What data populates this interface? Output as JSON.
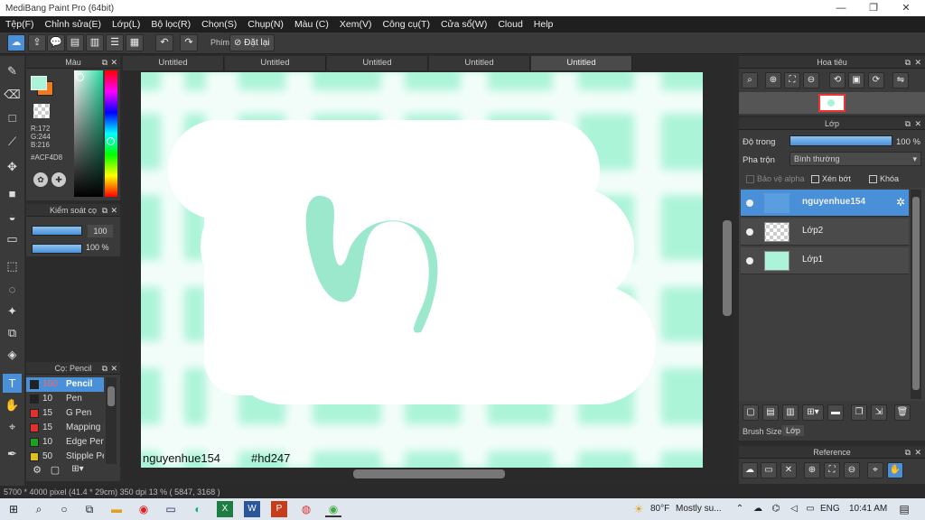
{
  "window": {
    "title": "MediBang Paint Pro (64bit)",
    "minimize": "—",
    "maximize": "❐",
    "close": "✕"
  },
  "menu": [
    "Tệp(F)",
    "Chỉnh sửa(E)",
    "Lớp(L)",
    "Bộ lọc(R)",
    "Chọn(S)",
    "Chụp(N)",
    "Màu (C)",
    "Xem(V)",
    "Công cụ(T)",
    "Cửa sổ(W)",
    "Cloud",
    "Help"
  ],
  "toolbar": {
    "shortcut_label": "Phím",
    "reset_label": "Đặt lại"
  },
  "color_panel": {
    "title": "Màu",
    "rgb": {
      "r": "R:172",
      "g": "G:244",
      "b": "B:216"
    },
    "hex": "#ACF4D8",
    "foreground": "#ACF4D8",
    "background": "#F07A20"
  },
  "control_panel": {
    "title": "Kiểm soát cọ",
    "size_value": "100",
    "opacity_value": "100 %"
  },
  "brush_panel": {
    "title": "Cọ: Pencil",
    "brushes": [
      {
        "size": "100",
        "name": "Pencil",
        "color": "#222222"
      },
      {
        "size": "10",
        "name": "Pen",
        "color": "#222222"
      },
      {
        "size": "15",
        "name": "G Pen",
        "color": "#e03030"
      },
      {
        "size": "15",
        "name": "Mapping P",
        "color": "#e03030"
      },
      {
        "size": "10",
        "name": "Edge Pen",
        "color": "#20a020"
      },
      {
        "size": "50",
        "name": "Stipple Pe",
        "color": "#e0c020"
      }
    ]
  },
  "tabs": [
    "Untitled",
    "Untitled",
    "Untitled",
    "Untitled",
    "Untitled"
  ],
  "canvas": {
    "caption_left": "nguyenhue154",
    "caption_right": "#hd247",
    "mint": "#ACF4D8"
  },
  "navigator": {
    "title": "Hoa tiêu"
  },
  "layer_panel": {
    "title": "Lớp",
    "opacity_label": "Độ trong",
    "opacity_value": "100 %",
    "blend_label": "Pha trộn",
    "blend_value": "Bình thường",
    "protect_alpha": "Bảo vệ alpha",
    "clipping": "Xén bớt",
    "lock": "Khóa",
    "layers": [
      {
        "name": "nguyenhue154"
      },
      {
        "name": "Lớp2"
      },
      {
        "name": "Lớp1"
      }
    ],
    "bottom_tabs": [
      "Brush Size",
      "Lớp"
    ]
  },
  "reference_panel": {
    "title": "Reference"
  },
  "status": {
    "text": "5700 * 4000 pixel  (41.4 * 29cm)  350 dpi  13 %  ( 5847, 3168 )"
  },
  "taskbar": {
    "weather_temp": "80°F",
    "weather_text": "Mostly su...",
    "language": "ENG",
    "time": "10:41 AM"
  }
}
